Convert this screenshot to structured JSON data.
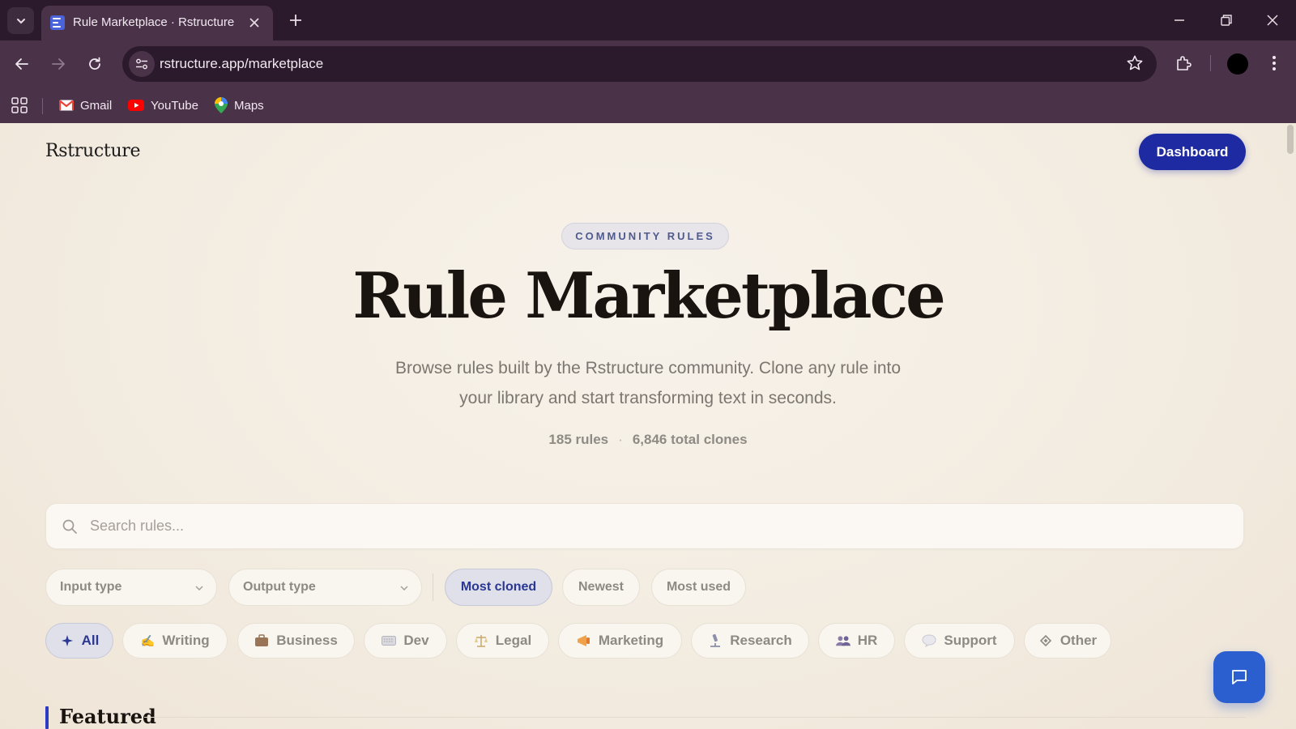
{
  "browser": {
    "tab_title": "Rule Marketplace · Rstructure",
    "url": "rstructure.app/marketplace",
    "bookmarks": [
      {
        "label": "Gmail",
        "icon": "gmail-icon"
      },
      {
        "label": "YouTube",
        "icon": "youtube-icon"
      },
      {
        "label": "Maps",
        "icon": "maps-icon"
      }
    ]
  },
  "header": {
    "brand": "Rstructure",
    "dashboard_label": "Dashboard"
  },
  "hero": {
    "eyebrow": "COMMUNITY RULES",
    "title": "Rule Marketplace",
    "subtitle_line1": "Browse rules built by the Rstructure community. Clone any rule into",
    "subtitle_line2": "your library and start transforming text in seconds.",
    "rules_count": "185 rules",
    "separator": "·",
    "clones_count": "6,846 total clones"
  },
  "search": {
    "placeholder": "Search rules..."
  },
  "filters": {
    "input_type": "Input type",
    "output_type": "Output type",
    "sort_options": [
      {
        "label": "Most cloned",
        "active": true
      },
      {
        "label": "Newest",
        "active": false
      },
      {
        "label": "Most used",
        "active": false
      }
    ]
  },
  "categories": [
    {
      "label": "All",
      "icon": "sparkle-icon",
      "active": true
    },
    {
      "label": "Writing",
      "icon": "writing-hand-icon",
      "active": false
    },
    {
      "label": "Business",
      "icon": "briefcase-icon",
      "active": false
    },
    {
      "label": "Dev",
      "icon": "keyboard-icon",
      "active": false
    },
    {
      "label": "Legal",
      "icon": "scales-icon",
      "active": false
    },
    {
      "label": "Marketing",
      "icon": "megaphone-icon",
      "active": false
    },
    {
      "label": "Research",
      "icon": "microscope-icon",
      "active": false
    },
    {
      "label": "HR",
      "icon": "people-icon",
      "active": false
    },
    {
      "label": "Support",
      "icon": "speech-bubble-icon",
      "active": false
    },
    {
      "label": "Other",
      "icon": "diamond-icon",
      "active": false
    }
  ],
  "featured": {
    "heading": "Featured"
  },
  "colors": {
    "accent": "#1e2aa1",
    "active_chip_bg": "#dfe0e9",
    "active_chip_text": "#2a3793",
    "chat_button": "#2b5fd0",
    "page_bg": "#f3ece1",
    "browser_chrome": "#4a3249"
  }
}
